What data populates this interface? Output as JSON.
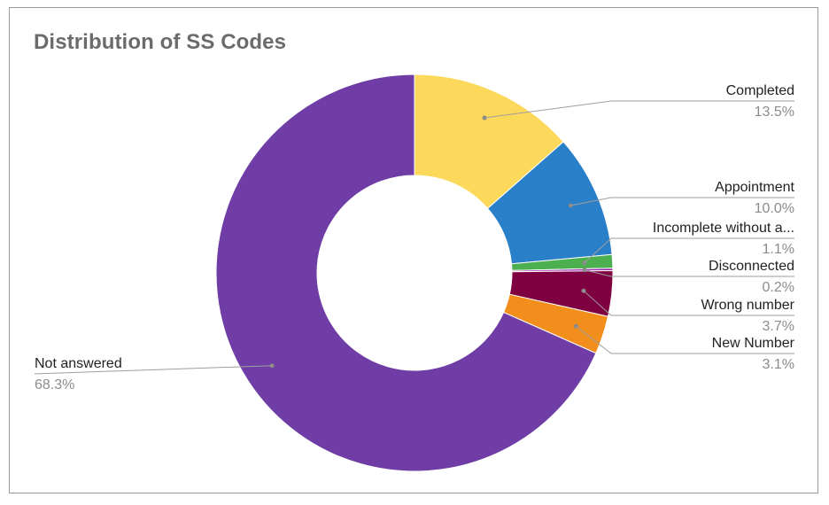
{
  "chart_data": {
    "type": "pie",
    "donut": true,
    "title": "Distribution of SS Codes",
    "slices": [
      {
        "label": "Completed",
        "value": 13.5,
        "display": "13.5%",
        "color": "#FCD95B"
      },
      {
        "label": "Appointment",
        "value": 10.0,
        "display": "10.0%",
        "color": "#2A7FC9"
      },
      {
        "label": "Incomplete without a...",
        "value": 1.1,
        "display": "1.1%",
        "color": "#4CB050"
      },
      {
        "label": "Disconnected",
        "value": 0.2,
        "display": "0.2%",
        "color": "#9C27B0"
      },
      {
        "label": "Wrong number",
        "value": 3.7,
        "display": "3.7%",
        "color": "#7E0041"
      },
      {
        "label": "New Number",
        "value": 3.1,
        "display": "3.1%",
        "color": "#F28E1C"
      },
      {
        "label": "Not answered",
        "value": 68.3,
        "display": "68.3%",
        "color": "#6F3DA5"
      }
    ],
    "legend": "labels-outside"
  }
}
